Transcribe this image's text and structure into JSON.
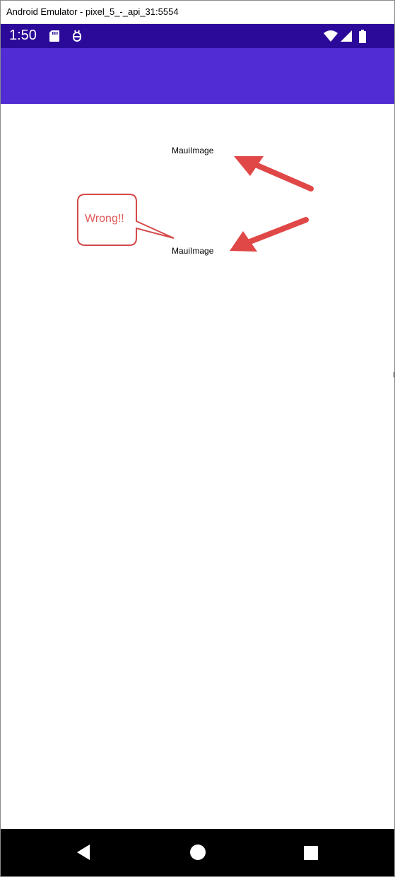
{
  "window": {
    "title": "Android Emulator - pixel_5_-_api_31:5554"
  },
  "statusbar": {
    "time": "1:50",
    "icons": [
      "sd-card-icon",
      "bug-icon",
      "wifi-icon",
      "signal-icon",
      "battery-icon"
    ]
  },
  "content": {
    "images": [
      {
        "label": "MauiImage"
      },
      {
        "label": "MauiImage"
      }
    ],
    "callout": {
      "text": "Wrong!!"
    }
  },
  "navbar": {
    "buttons": [
      "back-icon",
      "home-icon",
      "recents-icon"
    ]
  },
  "colors": {
    "statusbar": "#2b0a9a",
    "appbar": "#512bd4",
    "annotation": "#e05a5a",
    "navbar": "#000000"
  }
}
